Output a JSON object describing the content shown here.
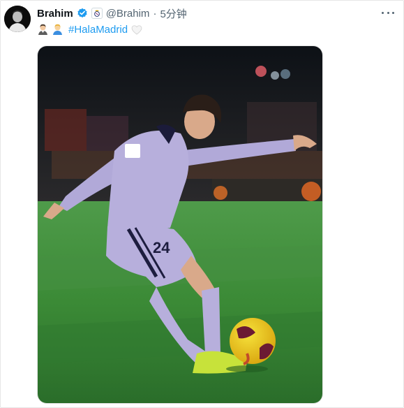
{
  "tweet": {
    "display_name": "Brahim",
    "handle": "@Brahim",
    "separator": "·",
    "time": "5分钟",
    "hashtag": "#HalaMadrid"
  },
  "icons": {
    "verified": "verified-badge-icon",
    "affiliate": "real-madrid-crest-icon",
    "more": "more-options-icon",
    "emoji_1": "man-emoji-icon",
    "emoji_2": "man-emoji-icon",
    "heart": "white-heart-emoji-icon"
  },
  "media": {
    "jersey_number": "24"
  },
  "colors": {
    "link": "#1d9bf0",
    "text_primary": "#0f1419",
    "text_secondary": "#536471",
    "verified": "#1d9bf0"
  }
}
